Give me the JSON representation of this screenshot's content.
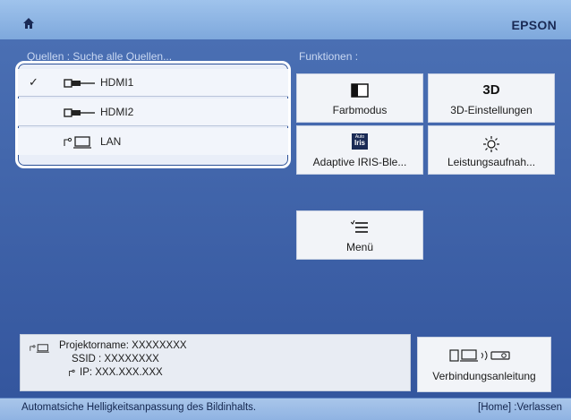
{
  "header": {
    "brand": "EPSON",
    "home_icon": "home-icon"
  },
  "sources": {
    "label": "Quellen : Suche alle Quellen...",
    "items": [
      {
        "label": "HDMI1",
        "selected": true,
        "icon": "hdmi-connector-icon"
      },
      {
        "label": "HDMI2",
        "selected": false,
        "icon": "hdmi-connector-icon"
      },
      {
        "label": "LAN",
        "selected": false,
        "icon": "lan-computer-icon"
      }
    ],
    "check": "✓"
  },
  "functions": {
    "label": "Funktionen :",
    "tiles": [
      {
        "label": "Farbmodus",
        "icon": "color-mode-icon"
      },
      {
        "label": "3D-Einstellungen",
        "icon": "3d-icon"
      },
      {
        "label": "Adaptive IRIS-Ble...",
        "icon": "auto-iris-icon"
      },
      {
        "label": "Leistungsaufnah...",
        "icon": "brightness-sun-icon"
      },
      {
        "label": "Menü",
        "icon": "menu-list-icon"
      }
    ]
  },
  "info": {
    "projector_name": "Projektorname: XXXXXXXX",
    "ssid": "SSID : XXXXXXXX",
    "ip": "IP: XXX.XXX.XXX"
  },
  "guide": {
    "label": "Verbindungsanleitung",
    "icon": "connection-guide-icon"
  },
  "statusbar": {
    "message": "Automatsiche Helligkeitsanpassung des Bildinhalts.",
    "exit": "[Home] :Verlassen"
  },
  "texts": {
    "icon_3d": "3D",
    "icon_auto": "Auto",
    "icon_iris": "Iris"
  }
}
